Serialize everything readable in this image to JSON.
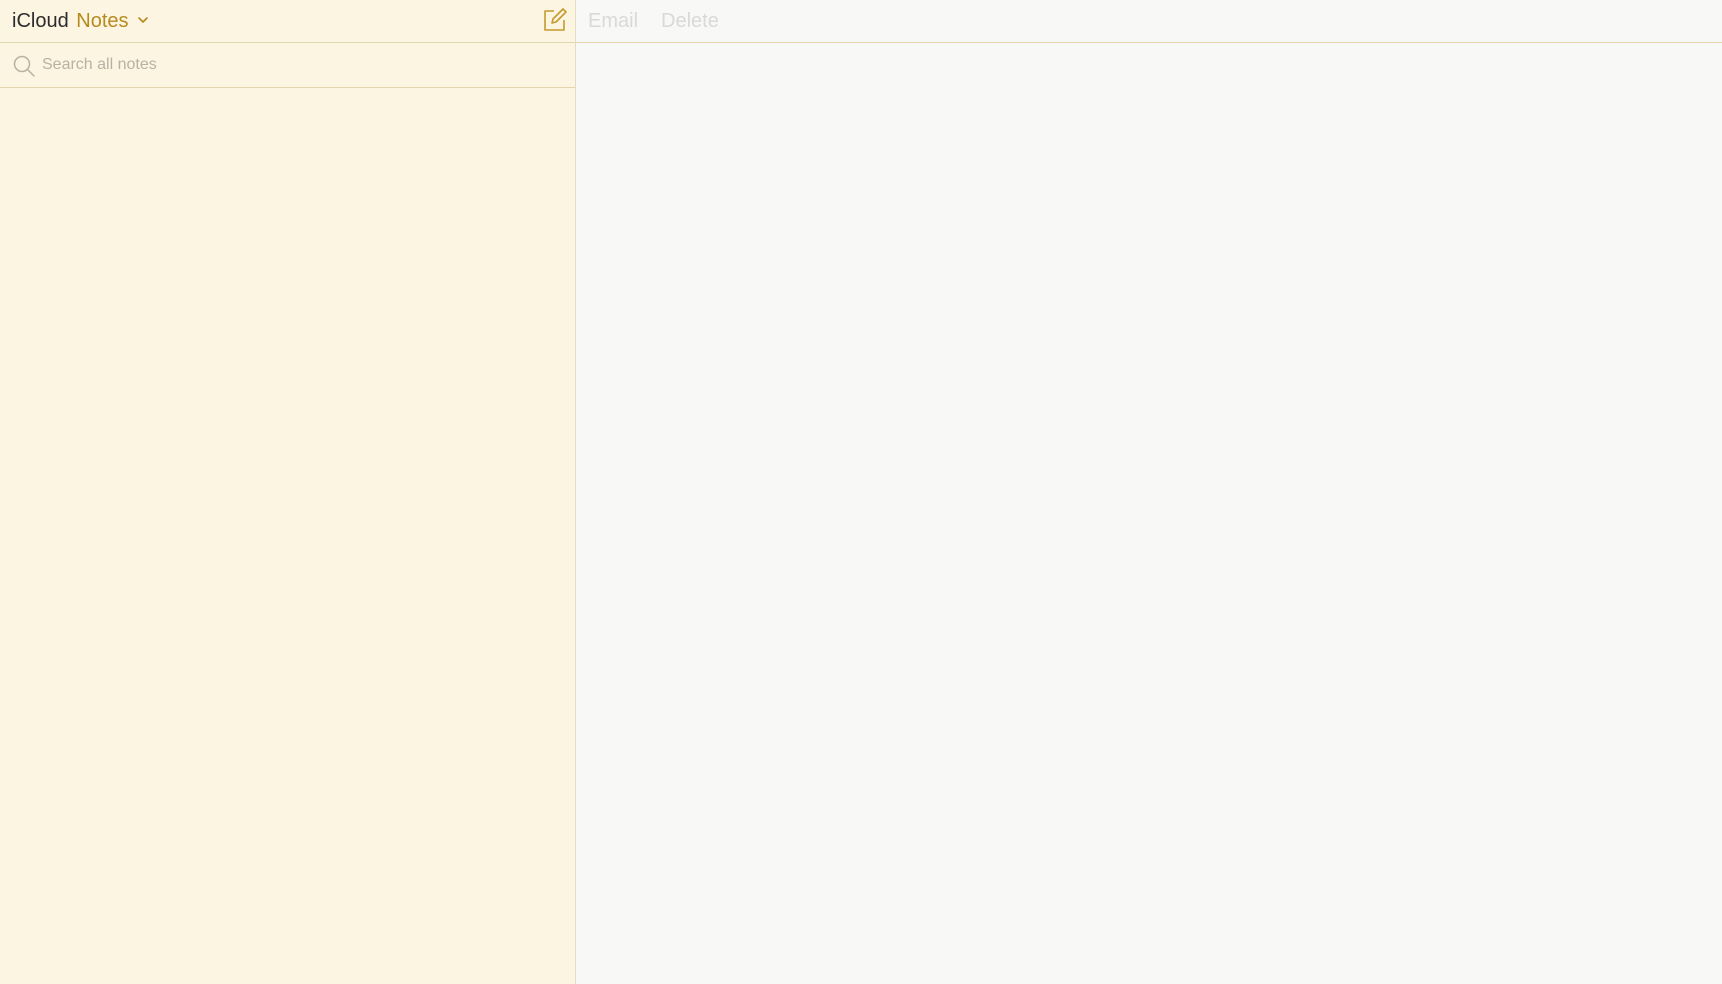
{
  "header": {
    "brand": "iCloud",
    "app_name": "Notes"
  },
  "search": {
    "placeholder": "Search all notes",
    "value": ""
  },
  "toolbar": {
    "email_label": "Email",
    "delete_label": "Delete"
  },
  "icons": {
    "compose": "compose-icon",
    "search": "search-icon",
    "dropdown": "chevron-down-icon"
  },
  "colors": {
    "accent": "#b88a1e",
    "sidebar_bg": "#fcf5e2",
    "editor_bg": "#f8f8f7",
    "divider": "#e3d6ae",
    "disabled_text": "#d9d9d9"
  },
  "notes": []
}
